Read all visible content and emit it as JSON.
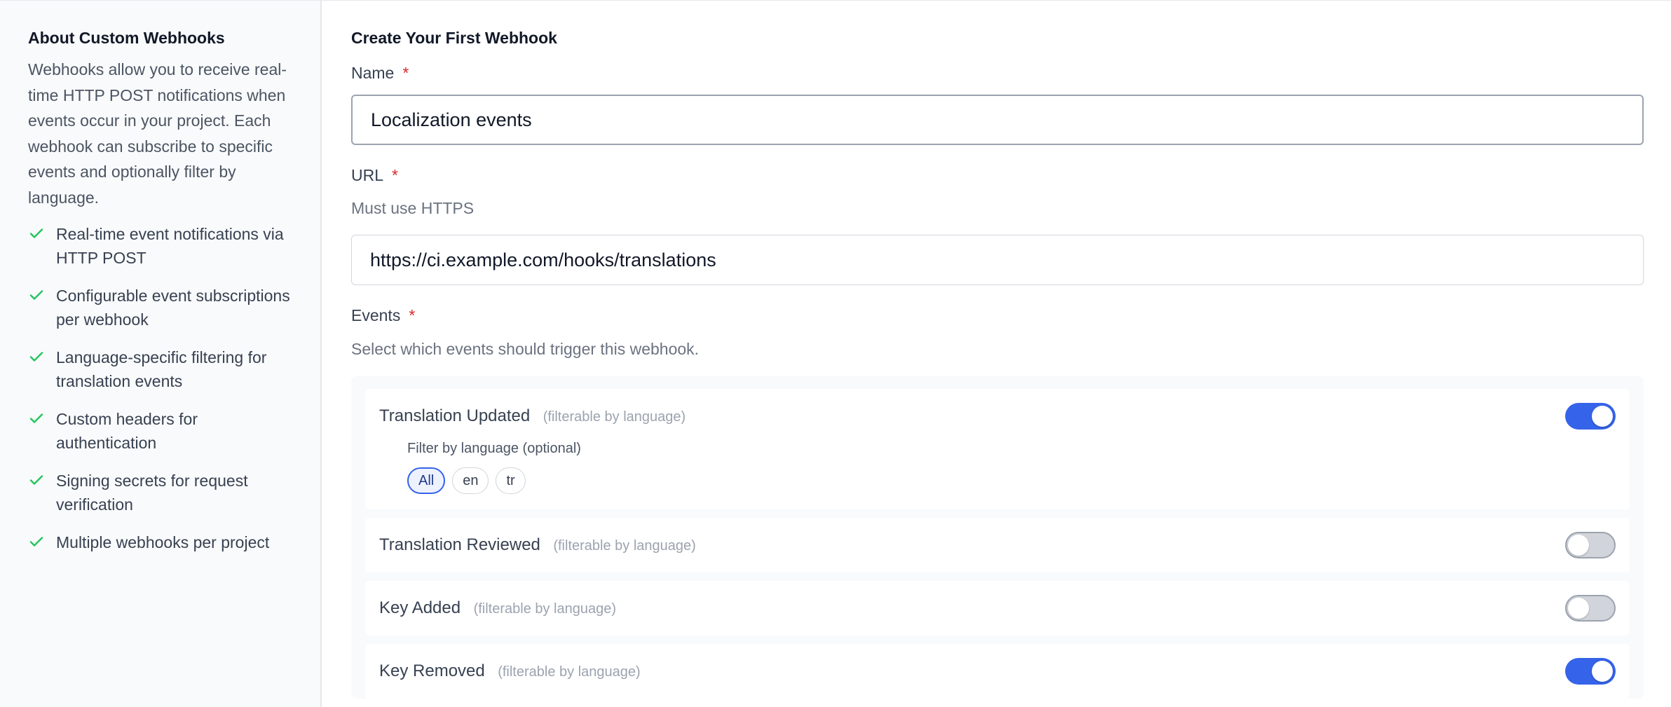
{
  "sidebar": {
    "title": "About Custom Webhooks",
    "description": "Webhooks allow you to receive real-time HTTP POST notifications when events occur in your project. Each webhook can subscribe to specific events and optionally filter by language.",
    "features": [
      "Real-time event notifications via HTTP POST",
      "Configurable event subscriptions per webhook",
      "Language-specific filtering for translation events",
      "Custom headers for authentication",
      "Signing secrets for request verification",
      "Multiple webhooks per project"
    ]
  },
  "form": {
    "title": "Create Your First Webhook",
    "name": {
      "label": "Name",
      "required_mark": "*",
      "value": "Localization events"
    },
    "url": {
      "label": "URL",
      "required_mark": "*",
      "hint": "Must use HTTPS",
      "value": "https://ci.example.com/hooks/translations"
    },
    "events": {
      "label": "Events",
      "required_mark": "*",
      "hint": "Select which events should trigger this webhook.",
      "items": [
        {
          "name": "Translation Updated",
          "note": "(filterable by language)",
          "enabled": true,
          "filter_label": "Filter by language (optional)",
          "languages": [
            "All",
            "en",
            "tr"
          ],
          "selected_language": "All"
        },
        {
          "name": "Translation Reviewed",
          "note": "(filterable by language)",
          "enabled": false
        },
        {
          "name": "Key Added",
          "note": "(filterable by language)",
          "enabled": false
        },
        {
          "name": "Key Removed",
          "note": "(filterable by language)",
          "enabled": true
        }
      ]
    }
  },
  "colors": {
    "accent": "#3563e9",
    "check": "#22c55e",
    "required": "#dc2626"
  }
}
